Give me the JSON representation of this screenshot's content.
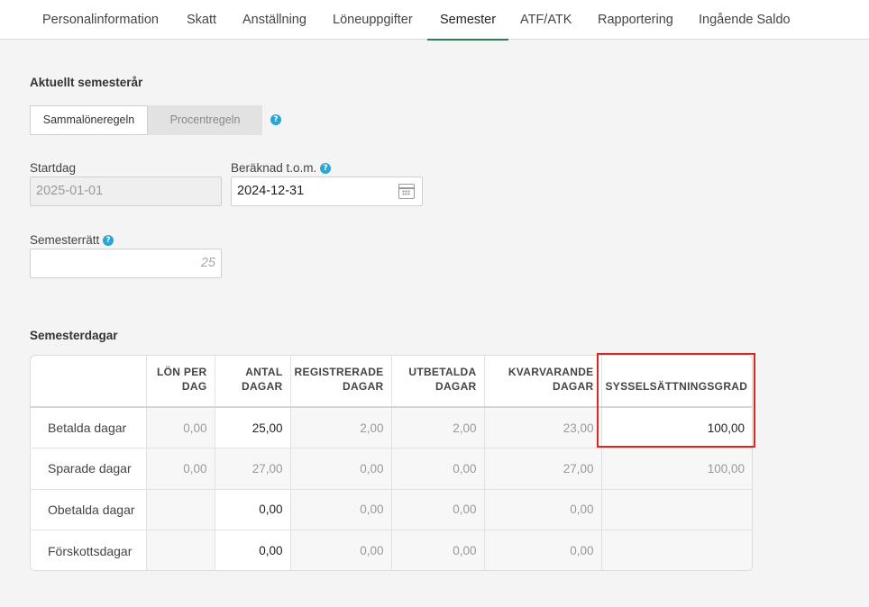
{
  "tabs": [
    {
      "label": "Personalinformation"
    },
    {
      "label": "Skatt"
    },
    {
      "label": "Anställning"
    },
    {
      "label": "Löneuppgifter"
    },
    {
      "label": "Semester",
      "active": true
    },
    {
      "label": "ATF/ATK"
    },
    {
      "label": "Rapportering"
    },
    {
      "label": "Ingående Saldo"
    }
  ],
  "current_year": {
    "title": "Aktuellt semesterår",
    "rule_options": [
      "Sammalöneregeln",
      "Procentregeln"
    ],
    "selected_rule": "Sammalöneregeln",
    "start_label": "Startdag",
    "start_value": "2025-01-01",
    "calc_label": "Beräknad t.o.m.",
    "calc_value": "2024-12-31",
    "entitlement_label": "Semesterrätt",
    "entitlement_placeholder": "25"
  },
  "vacation_days": {
    "title": "Semesterdagar",
    "headers": [
      "",
      "LÖN PER DAG",
      "ANTAL DAGAR",
      "REGISTRERADE DAGAR",
      "UTBETALDA DAGAR",
      "KVARVARANDE DAGAR",
      "SYSSELSÄTTNINGSGRAD"
    ],
    "rows": [
      {
        "label": "Betalda dagar",
        "cells": [
          "0,00",
          "25,00",
          "2,00",
          "2,00",
          "23,00",
          "100,00"
        ]
      },
      {
        "label": "Sparade dagar",
        "cells": [
          "0,00",
          "27,00",
          "0,00",
          "0,00",
          "27,00",
          "100,00"
        ]
      },
      {
        "label": "Obetalda dagar",
        "cells": [
          "",
          "0,00",
          "0,00",
          "0,00",
          "0,00",
          ""
        ]
      },
      {
        "label": "Förskottsdagar",
        "cells": [
          "",
          "0,00",
          "0,00",
          "0,00",
          "0,00",
          ""
        ]
      }
    ]
  },
  "colors": {
    "accent": "#2e7d4f",
    "help": "#2aa6d4",
    "highlight": "#e02424"
  },
  "icons": {
    "help": "question-circle-icon",
    "calendar": "calendar-icon"
  }
}
